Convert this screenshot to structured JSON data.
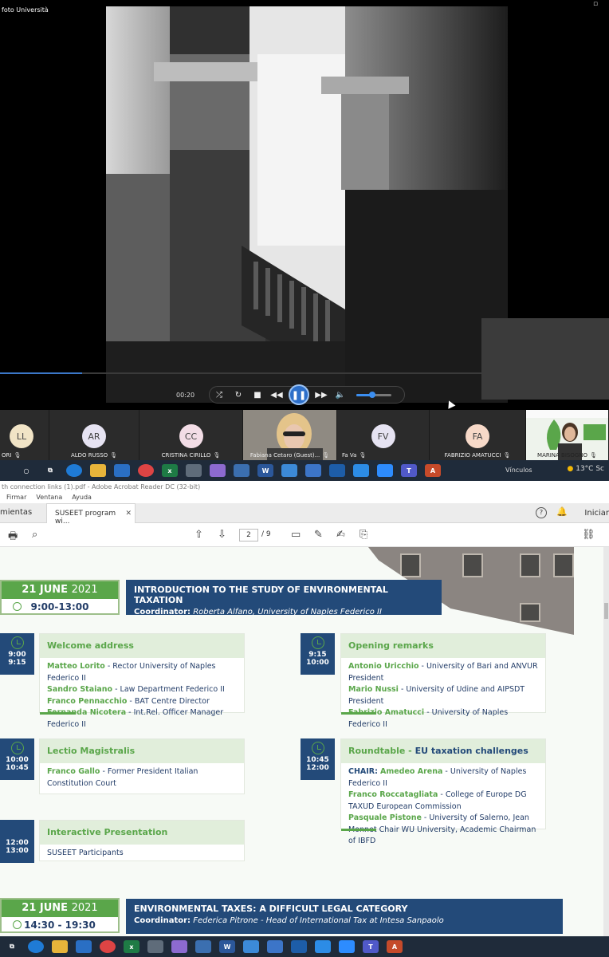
{
  "video": {
    "title": "foto Università",
    "elapsed": "00:20",
    "progress_fraction": 0.17,
    "volume_fraction": 0.45
  },
  "participants": [
    {
      "initials": "LL",
      "name": "ORI"
    },
    {
      "initials": "AR",
      "name": "ALDO RUSSO"
    },
    {
      "initials": "CC",
      "name": "CRISTINA CIRILLO"
    },
    {
      "initials": "",
      "name": "Fabiana Cetaro (Guest)..."
    },
    {
      "initials": "FV",
      "name": "Fa Va"
    },
    {
      "initials": "FA",
      "name": "FABRIZIO AMATUCCI"
    },
    {
      "initials": "",
      "name": "MARINA BISOGNO"
    }
  ],
  "taskbar": {
    "vinculos": "Vínculos",
    "weather": "13°C Sc"
  },
  "acrobat": {
    "title": "th connection links (1).pdf - Adobe Acrobat Reader DC (32-bit)",
    "menu": [
      "Firmar",
      "Ventana",
      "Ayuda"
    ],
    "tab_left": "mientas",
    "tab_doc": "SUSEET program wi...",
    "sign_in": "Iniciar",
    "page_current": "2",
    "page_total": "/ 9"
  },
  "pdf": {
    "day1": {
      "date_day": "21 JUNE",
      "date_year": "2021",
      "time": "9:00-13:00",
      "title": "INTRODUCTION TO THE STUDY OF ENVIRONMENTAL TAXATION",
      "coord_label": "Coordinator:",
      "coord_text": "Roberta Alfano, University of Naples Federico II"
    },
    "welcome": {
      "time1": "9:00",
      "time2": "9:15",
      "heading": "Welcome address",
      "lines": [
        {
          "name": "Matteo Lorito",
          "rest": " - Rector University of Naples Federico II"
        },
        {
          "name": "Sandro Staiano",
          "rest": " - Law Department Federico II"
        },
        {
          "name": "Franco Pennacchio",
          "rest": " - BAT Centre Director"
        },
        {
          "name": "Fernanda Nicotera",
          "rest": " - Int.Rel. Officer Manager Federico II"
        }
      ]
    },
    "opening": {
      "time1": "9:15",
      "time2": "10:00",
      "heading": "Opening remarks",
      "lines": [
        {
          "name": "Antonio Uricchio",
          "rest": " - University of Bari and ANVUR President"
        },
        {
          "name": "Mario Nussi",
          "rest": " - University of Udine and AIPSDT President"
        },
        {
          "name": "Fabrizio Amatucci",
          "rest": " - University of Naples Federico II"
        }
      ]
    },
    "lectio": {
      "time1": "10:00",
      "time2": "10:45",
      "heading": "Lectio Magistralis",
      "lines": [
        {
          "name": "Franco Gallo",
          "rest": " - Former President Italian Constitution Court"
        }
      ]
    },
    "roundtable": {
      "time1": "10:45",
      "time2": "12:00",
      "heading_green": "Roundtable - ",
      "heading_blue": "EU taxation challenges",
      "chair_label": "CHAIR:",
      "lines": [
        {
          "name": "Amedeo Arena",
          "rest": " - University of Naples Federico II"
        },
        {
          "name": "Franco Roccatagliata",
          "rest": " - College of Europe DG TAXUD European Commission"
        },
        {
          "name": "Pasquale Pistone",
          "rest": " - University of Salerno, Jean Monnet Chair WU University, Academic Chairman of IBFD"
        }
      ]
    },
    "interactive": {
      "time1": "12:00",
      "time2": "13:00",
      "heading": "Interactive Presentation",
      "body": "SUSEET Participants"
    },
    "day2": {
      "date_day": "21 JUNE",
      "date_year": "2021",
      "time": "14:30 - 19:30",
      "title": "ENVIRONMENTAL TAXES: A DIFFICULT LEGAL CATEGORY",
      "coord_label": "Coordinator:",
      "coord_text": "Federica Pitrone - Head of International Tax at Intesa Sanpaolo"
    }
  }
}
